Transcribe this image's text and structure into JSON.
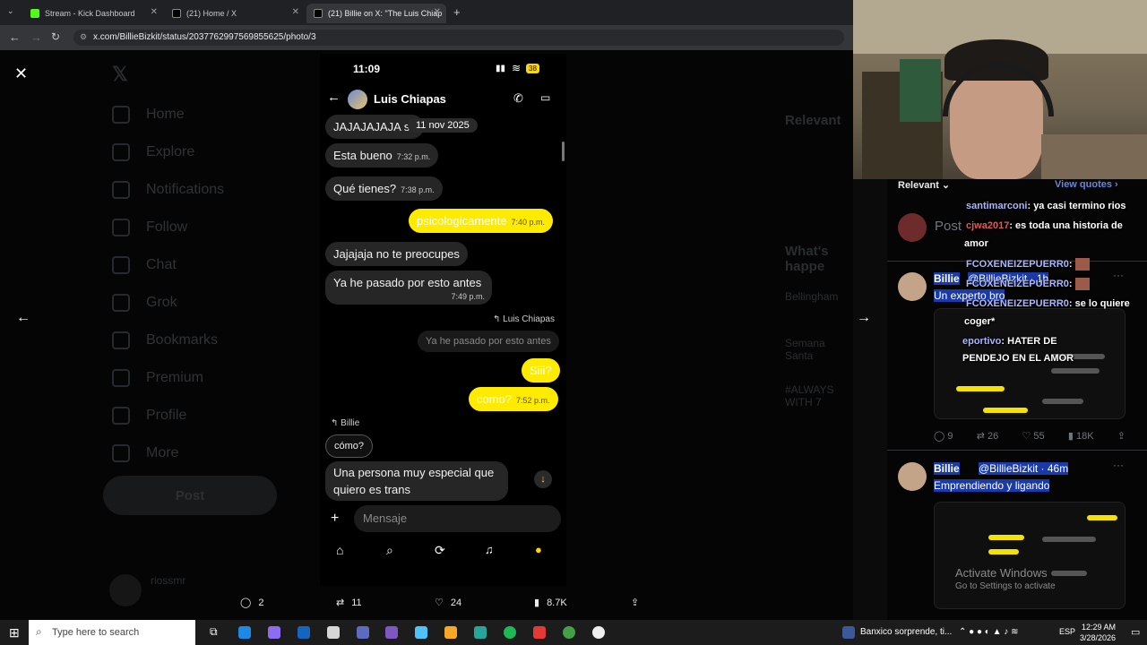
{
  "browser": {
    "tabs": [
      {
        "title": "Stream - Kick Dashboard",
        "active": false
      },
      {
        "title": "(21) Home / X",
        "active": false
      },
      {
        "title": "(21) Billie on X: \"The Luis Chiap",
        "active": true
      }
    ],
    "url": "x.com/BillieBizkit/status/2037762997569855625/photo/3"
  },
  "x_sidebar": {
    "items": [
      "Home",
      "Explore",
      "Notifications",
      "Follow",
      "Chat",
      "Grok",
      "Bookmarks",
      "Premium",
      "Profile",
      "More"
    ],
    "post_button": "Post",
    "user_name": "riossmr"
  },
  "phone": {
    "time": "11:09",
    "battery": "38",
    "contact": "Luis Chiapas",
    "date_badge": "11 nov 2025",
    "messages": [
      {
        "text": "JAJAJAJAJA se",
        "dir": "in",
        "time": ""
      },
      {
        "text": "Esta bueno",
        "dir": "in",
        "time": "7:32 p.m."
      },
      {
        "text": "Qué tienes?",
        "dir": "in",
        "time": "7:38 p.m."
      },
      {
        "text": "psicologicamente",
        "dir": "out",
        "time": "7:40 p.m."
      },
      {
        "text": "Jajajaja no te preocupes",
        "dir": "in",
        "time": ""
      },
      {
        "text": "Ya he pasado por esto antes",
        "dir": "in",
        "time": "7:49 p.m."
      },
      {
        "text": "Ya he pasado por esto antes",
        "dir": "quote",
        "time": ""
      },
      {
        "text": "Siii?",
        "dir": "out",
        "time": ""
      },
      {
        "text": "como?",
        "dir": "out",
        "time": "7:52 p.m."
      },
      {
        "text": "cómo?",
        "dir": "quote-in",
        "time": ""
      },
      {
        "text": "Una persona muy especial que",
        "dir": "in",
        "time": ""
      },
      {
        "text": "quiero es trans",
        "dir": "in",
        "time": ""
      }
    ],
    "reply_to_luis": "Luis Chiapas",
    "reply_to_billie": "Billie",
    "input_placeholder": "Mensaje"
  },
  "actions": {
    "replies": "2",
    "reposts": "11",
    "likes": "24",
    "views": "8.7K"
  },
  "right_panel": {
    "relevant_label": "Relevant",
    "view_quotes": "View quotes",
    "post_placeholder": "Post",
    "post1": {
      "name": "Billie",
      "handle": "@BillieBizkit · 1h",
      "text": "Un experto bro",
      "replies": "9",
      "reposts": "26",
      "likes": "55",
      "views": "18K"
    },
    "post2": {
      "name": "Billie",
      "handle": "@BillieBizkit · 46m",
      "text": "Emprendiendo y ligando"
    },
    "activate": "Activate Windows",
    "activate_sub": "Go to Settings to activate"
  },
  "stream_chat": [
    {
      "name": "santimarconi",
      "msg": ": ya casi termino rios"
    },
    {
      "name": "cjwa2017",
      "msg": ": es toda una historia de"
    },
    {
      "name": "",
      "msg": "amor"
    },
    {
      "name": "FCOXENEIZEPUERR0",
      "msg": ":"
    },
    {
      "name": "FCOXENEIZEPUERR0",
      "msg": ":"
    },
    {
      "name": "FCOXENEIZEPUERR0",
      "msg": ": se lo quiere"
    },
    {
      "name": "",
      "msg": "coger*"
    },
    {
      "name": "eportivo",
      "msg": ": HATER DE"
    },
    {
      "name": "",
      "msg": "PENDEJO EN EL AMOR"
    }
  ],
  "x_trending": {
    "relevant": "Relevant",
    "happening": "What's happe",
    "t1": "Bellingham",
    "t2": "Semana Santa",
    "t3": "#ALWAYS WITH 7"
  },
  "taskbar": {
    "search_placeholder": "Type here to search",
    "news": "Banxico sorprende, ti...",
    "lang": "ESP",
    "time": "12:29 AM",
    "date": "3/28/2026"
  }
}
